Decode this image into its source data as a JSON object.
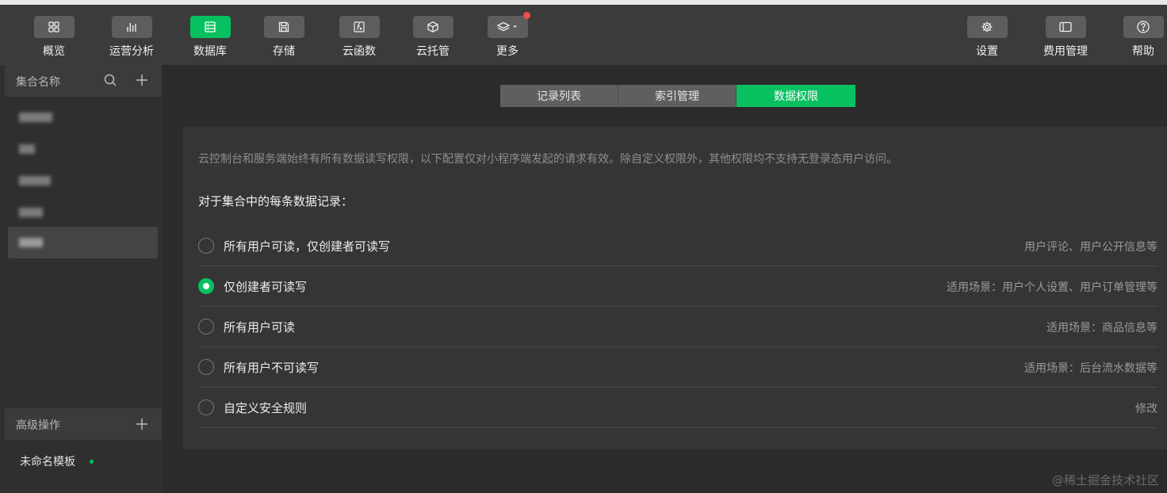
{
  "toolbar": {
    "left": [
      {
        "label": "概览",
        "icon": "grid-icon"
      },
      {
        "label": "运营分析",
        "icon": "bar-chart-icon"
      },
      {
        "label": "数据库",
        "icon": "database-icon",
        "active": true
      },
      {
        "label": "存储",
        "icon": "save-icon"
      },
      {
        "label": "云函数",
        "icon": "function-icon"
      },
      {
        "label": "云托管",
        "icon": "cube-icon"
      },
      {
        "label": "更多",
        "icon": "layers-icon",
        "has_dropdown": true,
        "notification": true
      }
    ],
    "right": [
      {
        "label": "设置",
        "icon": "gear-icon"
      },
      {
        "label": "费用管理",
        "icon": "billing-icon"
      },
      {
        "label": "帮助",
        "icon": "help-icon"
      }
    ]
  },
  "sidebar": {
    "collections_title": "集合名称",
    "search_icon": "search-icon",
    "add_icon": "plus-icon",
    "advanced_title": "高级操作",
    "template_name": "未命名模板",
    "template_status_color": "#07c160"
  },
  "tabs": [
    {
      "label": "记录列表"
    },
    {
      "label": "索引管理"
    },
    {
      "label": "数据权限",
      "active": true
    }
  ],
  "permissions": {
    "notice": "云控制台和服务端始终有所有数据读写权限，以下配置仅对小程序端发起的请求有效。除自定义权限外，其他权限均不支持无登录态用户访问。",
    "section_title": "对于集合中的每条数据记录：",
    "options": [
      {
        "label": "所有用户可读，仅创建者可读写",
        "hint": "用户评论、用户公开信息等",
        "checked": false
      },
      {
        "label": "仅创建者可读写",
        "hint": "适用场景：用户个人设置、用户订单管理等",
        "checked": true
      },
      {
        "label": "所有用户可读",
        "hint": "适用场景：商品信息等",
        "checked": false
      },
      {
        "label": "所有用户不可读写",
        "hint": "适用场景：后台流水数据等",
        "checked": false
      },
      {
        "label": "自定义安全规则",
        "hint": "修改",
        "checked": false
      }
    ]
  },
  "watermark": "@稀土掘金技术社区",
  "colors": {
    "accent": "#07c160",
    "notification": "#f04d4d"
  }
}
